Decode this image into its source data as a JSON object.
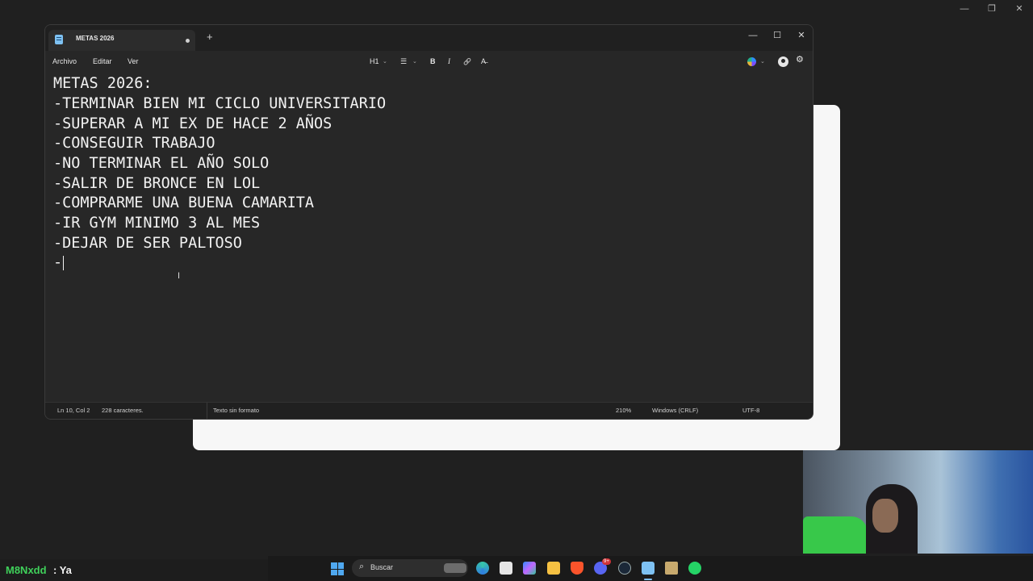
{
  "screen": {
    "minimize_glyph": "—",
    "restore_glyph": "❐",
    "close_glyph": "✕"
  },
  "notepad": {
    "tab_title": "METAS 2026",
    "new_tab_glyph": "+",
    "window_buttons": {
      "minimize": "—",
      "maximize": "☐",
      "close": "✕"
    },
    "menu": [
      "Archivo",
      "Editar",
      "Ver"
    ],
    "toolbar": {
      "heading": "H1",
      "list_icon": "☰",
      "bold": "B",
      "italic": "I",
      "link_icon": "🔗",
      "clear_format": "A̶",
      "settings_icon": "⚙"
    },
    "content_lines": [
      "METAS 2026:",
      "-TERMINAR BIEN MI CICLO UNIVERSITARIO",
      "-SUPERAR A MI EX DE HACE 2 AÑOS",
      "-CONSEGUIR TRABAJO",
      "-NO TERMINAR EL AÑO SOLO",
      "-SALIR DE BRONCE EN LOL",
      "-COMPRARME UNA BUENA CAMARITA",
      "-IR GYM MINIMO 3 AL MES",
      "-DEJAR DE SER PALTOSO",
      "-"
    ],
    "status": {
      "position": "Ln 10, Col 2",
      "characters": "228 caracteres.",
      "format": "Texto sin formato",
      "zoom": "210%",
      "line_ending": "Windows (CRLF)",
      "encoding": "UTF-8"
    }
  },
  "chat": {
    "user": "M8Nxdd",
    "message": ": Ya"
  },
  "taskbar": {
    "search_placeholder": "Buscar",
    "apps": [
      "edge-icon",
      "store-icon",
      "copilot-icon",
      "file-explorer-icon",
      "brave-icon",
      "discord-icon",
      "steam-icon",
      "notepad-icon",
      "league-icon",
      "whatsapp-icon"
    ],
    "discord_badge": "9+"
  },
  "colors": {
    "accent": "#7fbfff",
    "chat_user": "#3fd05a",
    "whatsapp": "#25d366",
    "brave": "#fb542b",
    "discord": "#5865f2",
    "explorer": "#f6c142"
  }
}
